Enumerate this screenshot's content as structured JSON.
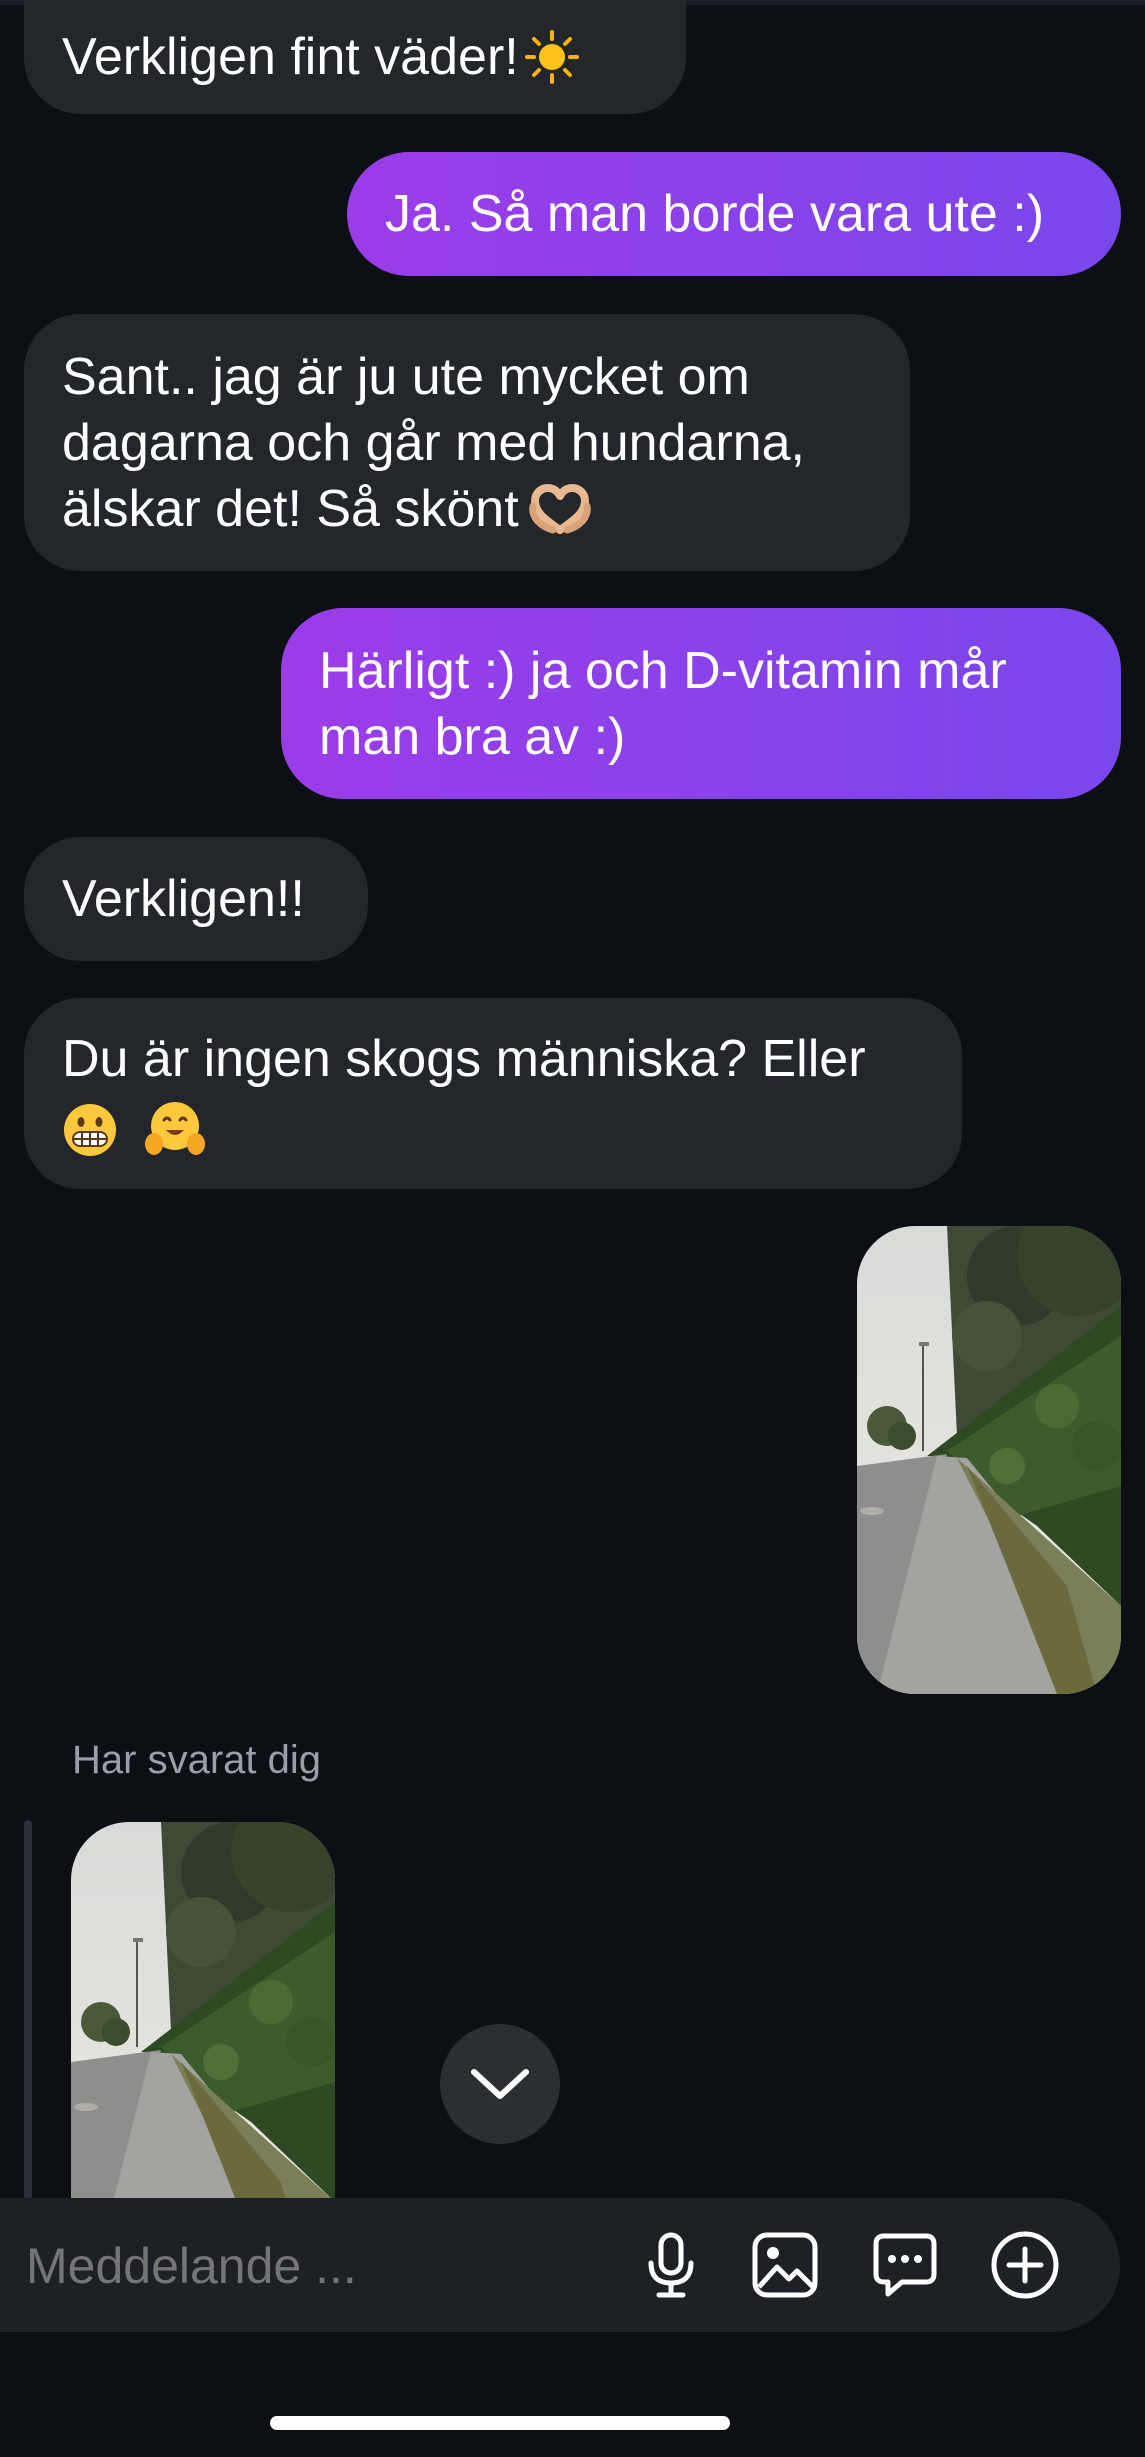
{
  "messages": [
    {
      "side": "in",
      "text": "Verkligen fint väder!",
      "emoji": "sun-emoji"
    },
    {
      "side": "out",
      "text": "Ja. Så man borde vara ute :)"
    },
    {
      "side": "in",
      "text": "Sant.. jag är ju ute mycket om\ndagarna och går med hundarna,\nälskar det! Så skönt",
      "emoji": "heart-hands-emoji"
    },
    {
      "side": "out",
      "text": "Härligt :) ja och D-vitamin mår\nman bra av :)"
    },
    {
      "side": "in",
      "text": "Verkligen!!"
    },
    {
      "side": "in",
      "text": "Du är ingen skogs människa? Eller",
      "emoji": "grimacing-face-emoji, hugging-face-emoji"
    },
    {
      "side": "out",
      "type": "photo",
      "content": "path beside hedge"
    }
  ],
  "reply": {
    "label": "Har svarat dig",
    "type": "photo"
  },
  "scroll_button": {
    "icon": "chevron-down-icon"
  },
  "composer": {
    "placeholder": "Meddelande ...",
    "icons": [
      "microphone-icon",
      "image-icon",
      "chat-bubble-icon",
      "add-circle-icon"
    ]
  },
  "colors": {
    "background": "#0c0f14",
    "incoming_bubble": "#23262b",
    "outgoing_bubble_start": "#9b3ce9",
    "outgoing_bubble_end": "#7a47ea",
    "muted_text": "#9a9ea6"
  }
}
